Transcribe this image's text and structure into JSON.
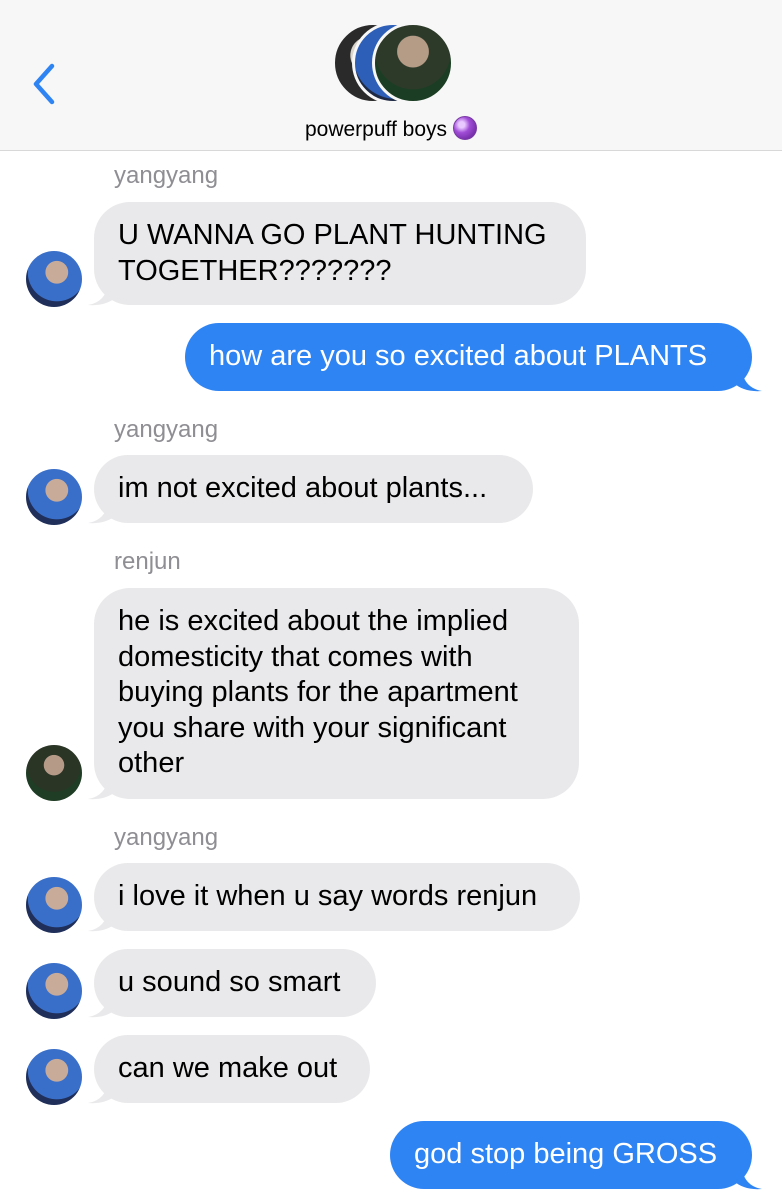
{
  "header": {
    "back_icon": "chevron-left-icon",
    "group_name": "powerpuff boys",
    "group_emoji": "crystal-ball-icon",
    "accent_color": "#2f84f4"
  },
  "messages": [
    {
      "sender": "yangyang",
      "text": "U WANNA GO PLANT HUNTING\nTOGETHER???????",
      "direction": "received"
    },
    {
      "text": "how are you so excited about PLANTS",
      "direction": "sent"
    },
    {
      "sender": "yangyang",
      "text": "im not excited about plants...",
      "direction": "received"
    },
    {
      "sender": "renjun",
      "text": "he is excited about the implied\ndomesticity that comes with\nbuying plants for the apartment\nyou share with your significant\nother",
      "direction": "received"
    },
    {
      "sender": "yangyang",
      "text": "i love it when u say words renjun",
      "direction": "received"
    },
    {
      "text": "u sound so smart",
      "direction": "received"
    },
    {
      "text": "can we make out",
      "direction": "received"
    },
    {
      "text": "god stop being GROSS",
      "direction": "sent"
    }
  ]
}
